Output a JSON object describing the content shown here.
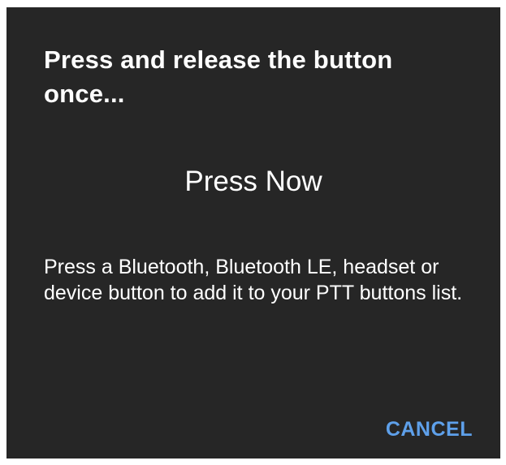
{
  "dialog": {
    "title": "Press and release the button once...",
    "status": "Press Now",
    "message": "Press a Bluetooth, Bluetooth LE, headset or device button to add it to your PTT buttons list.",
    "cancel_label": "CANCEL"
  },
  "colors": {
    "background": "#262626",
    "text": "#ffffff",
    "accent": "#5ea0ea"
  }
}
